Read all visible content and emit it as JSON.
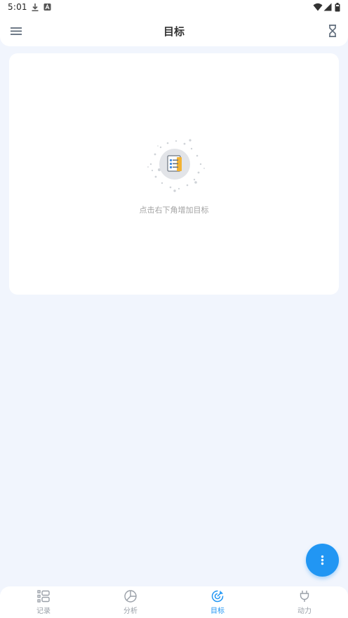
{
  "status_bar": {
    "time": "5:01",
    "icons": [
      "download-icon",
      "a-badge-icon",
      "wifi-icon",
      "signal-icon",
      "battery-icon"
    ]
  },
  "app_bar": {
    "title": "目标",
    "left_icon": "menu-icon",
    "right_icon": "hourglass-icon"
  },
  "empty_state": {
    "message": "点击右下角增加目标",
    "icon": "document-icon"
  },
  "fab": {
    "icon": "more-vertical-icon"
  },
  "bottom_nav": {
    "active_index": 2,
    "items": [
      {
        "label": "记录",
        "icon": "list-icon"
      },
      {
        "label": "分析",
        "icon": "pie-chart-icon"
      },
      {
        "label": "目标",
        "icon": "target-icon"
      },
      {
        "label": "动力",
        "icon": "plug-icon"
      }
    ]
  },
  "colors": {
    "accent": "#2196f3",
    "background": "#f1f5fd",
    "inactive": "#9aa0a8",
    "text_muted": "#a3a3a3"
  }
}
